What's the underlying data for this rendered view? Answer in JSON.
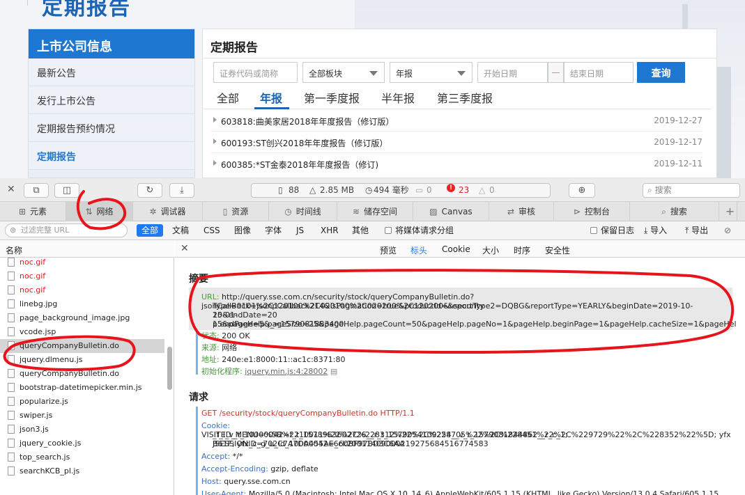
{
  "site": {
    "title": "定期报告",
    "nav_header": "上市公司信息",
    "nav_items": [
      "最新公告",
      "发行上市公告",
      "定期报告预约情况",
      "定期报告"
    ],
    "main_title": "定期报告",
    "search_placeholder": "证券代码或简称",
    "board_select": "全部板块",
    "type_select": "年报",
    "start_placeholder": "开始日期",
    "date_sep": "—",
    "end_placeholder": "结束日期",
    "query_label": "查询",
    "tabs": [
      "全部",
      "年报",
      "第一季度报",
      "半年报",
      "第三季度报"
    ],
    "reports": [
      {
        "title": "603818:曲美家居2018年年度报告（修订版）",
        "date": "2019-12-27"
      },
      {
        "title": "600193:ST创兴2018年年度报告（修订版）",
        "date": "2019-12-17"
      },
      {
        "title": "600385:*ST金泰2018年年度报告（修订)",
        "date": "2019-12-11"
      }
    ]
  },
  "devtools": {
    "stats": {
      "docs": "88",
      "size": "2.85 MB",
      "time": "494 毫秒",
      "msgs": "0",
      "errors": "23",
      "warnings": "0"
    },
    "search_placeholder": "搜索",
    "tabs": [
      "元素",
      "网络",
      "调试器",
      "资源",
      "时间线",
      "储存空间",
      "Canvas",
      "审核",
      "控制台",
      "搜索"
    ],
    "filter_placeholder": "过滤完整 URL",
    "types": [
      "全部",
      "文稿",
      "CSS",
      "图像",
      "字体",
      "JS",
      "XHR",
      "其他"
    ],
    "group_media": "将媒体请求分组",
    "preserve_log": "保留日志",
    "import_label": "导入",
    "export_label": "导出",
    "list_header": "名称",
    "files": [
      {
        "name": "noc.gif",
        "error": true
      },
      {
        "name": "noc.gif",
        "error": true
      },
      {
        "name": "noc.gif",
        "error": true
      },
      {
        "name": "linebg.jpg",
        "error": false
      },
      {
        "name": "page_background_image.jpg",
        "error": false
      },
      {
        "name": "vcode.jsp",
        "error": false
      },
      {
        "name": "queryCompanyBulletin.do",
        "error": false
      },
      {
        "name": "jquery.dlmenu.js",
        "error": false
      },
      {
        "name": "queryCompanyBulletin.do",
        "error": false
      },
      {
        "name": "bootstrap-datetimepicker.min.js",
        "error": false
      },
      {
        "name": "popularize.js",
        "error": false
      },
      {
        "name": "swiper.js",
        "error": false
      },
      {
        "name": "json3.js",
        "error": false
      },
      {
        "name": "jquery_cookie.js",
        "error": false
      },
      {
        "name": "top_search.js",
        "error": false
      },
      {
        "name": "searchKCB_pl.js",
        "error": false
      }
    ],
    "detail_tabs": [
      "预览",
      "标头",
      "Cookie",
      "大小",
      "时序",
      "安全性"
    ],
    "summary_title": "摘要",
    "url_key": "URL:",
    "url_lines": [
      "http://query.sse.com.cn/security/stock/queryCompanyBulletin.do?jsonCallBack=jsonpCallback214&isPagination=true&productId=&security",
      "Type=0101%2C120100%2C020100%2C020200%2C120200&reportType2=DQBG&reportType=YEARLY&beginDate=2019-10-15&endDate=20",
      "20-01-15&pageHelp.pageSize=25&pageHelp.pageCount=50&pageHelp.pageNo=1&pageHelp.beginPage=1&pageHelp.cacheSize=1&pageHel",
      "p.endPage=5&_=1579081883400"
    ],
    "status_key": "状态:",
    "status_val": "200 OK",
    "source_key": "来源:",
    "source_val": "网络",
    "address_key": "地址:",
    "address_val": "240e:e1:8000:11::ac1c:8371:80",
    "initiator_key": "初始化程序:",
    "initiator_val": "jquery.min.js:4:28002",
    "request_title": "请求",
    "req_line": "GET /security/stock/queryCompanyBulletin.do HTTP/1.1",
    "cookie_key": "Cookie:",
    "cookie_lines": [
      "VISITED_MENU=%5B%2210011%22%2C%228312%22%2C%228705%22%2C%228451%22%2C%229729%22%2C%228352%22%5D; yfx",
      "_f_l_v_t_10000042=f_t_1578963602726__r_t_1579054109254__v_t_1579081844862__r_c_1; JSESSIONID=702C7A7DA455AE660BF97BD3C6AA",
      "B61F; yfx_c_g_u_id_10000042=_ck20011409000219275684516774583"
    ],
    "accept_key": "Accept:",
    "accept_val": "*/*",
    "enc_key": "Accept-Encoding:",
    "enc_val": "gzip, deflate",
    "host_key": "Host:",
    "host_val": "query.sse.com.cn",
    "ua_key": "User-Agent:",
    "ua_val": "Mozilla/5.0 (Macintosh; Intel Mac OS X 10_14_6) AppleWebKit/605.1.15 (KHTML, like Gecko) Version/13.0.4 Safari/605.1.15"
  },
  "colors": {
    "brand_blue": "#1e78d2",
    "annotation_red": "#e8141b",
    "error_text": "#dd2222"
  }
}
